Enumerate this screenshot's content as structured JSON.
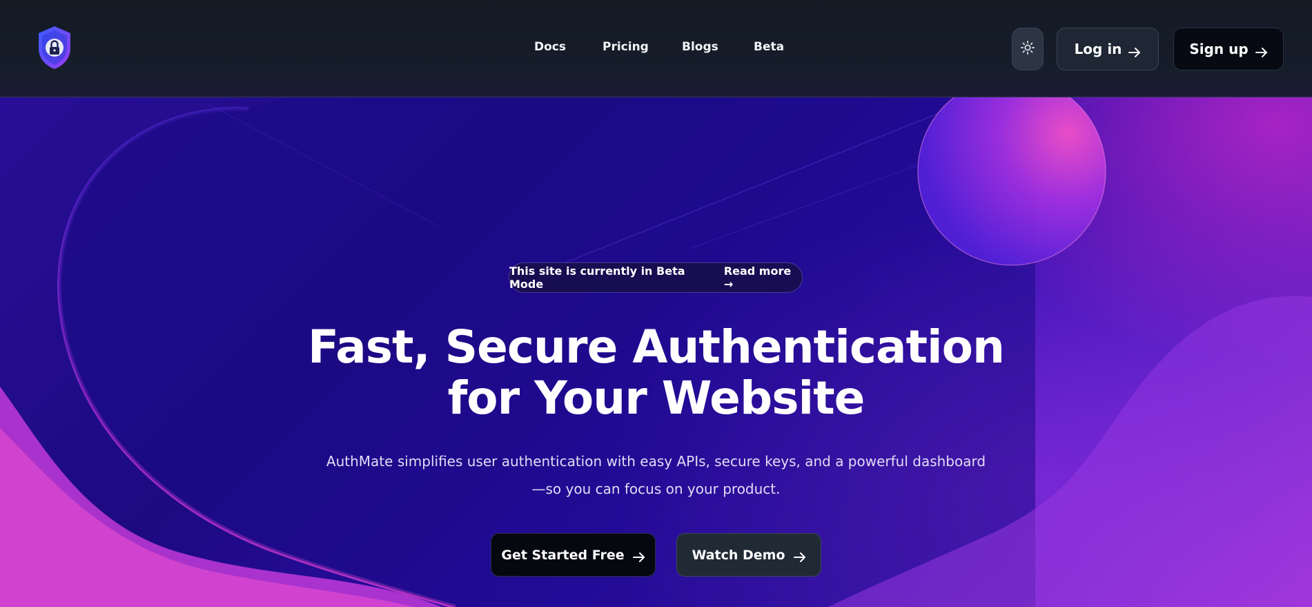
{
  "header": {
    "logo_icon": "shield-lock-icon",
    "nav": [
      {
        "label": "Docs"
      },
      {
        "label": "Pricing"
      },
      {
        "label": "Blogs"
      },
      {
        "label": "Beta"
      }
    ],
    "theme_toggle_icon": "sun-icon",
    "login_label": "Log in",
    "signup_label": "Sign up"
  },
  "hero": {
    "beta_notice": "This site is currently in Beta Mode",
    "read_more": "Read more →",
    "headline_line1": "Fast, Secure Authentication",
    "headline_line2": "for Your Website",
    "subtext_line1": "AuthMate simplifies user authentication with easy APIs, secure keys, and a powerful dashboard",
    "subtext_line2": "—so you can focus on your product.",
    "cta_primary": "Get Started Free",
    "cta_secondary": "Watch Demo"
  },
  "colors": {
    "header_bg": "#131a24",
    "hero_deep": "#1d0a80",
    "hero_magenta": "#c828c8",
    "button_dark": "#060810",
    "button_slate": "#202a35"
  }
}
